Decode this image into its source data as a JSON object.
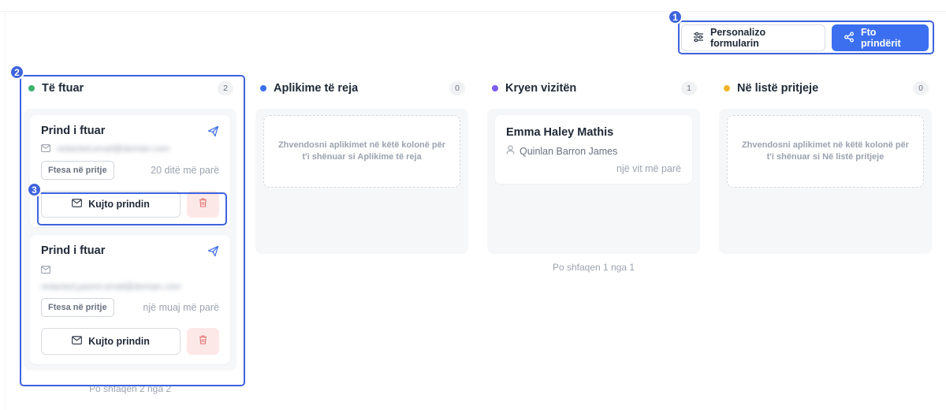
{
  "toolbar": {
    "customize_label": "Personalizo formularin",
    "invite_label": "Fto prindërit"
  },
  "annotations": [
    "1",
    "2",
    "3"
  ],
  "columns": [
    {
      "title": "Të ftuar",
      "count": "2",
      "color": "#3cb371",
      "cards": [
        {
          "title": "Prind i ftuar",
          "email": "redacted.email@domain.com",
          "status": "Ftesa në pritje",
          "time": "20 ditë më parë",
          "remind_label": "Kujto prindin"
        },
        {
          "title": "Prind i ftuar",
          "email": "redacted.parent.email@domain.com",
          "status": "Ftesa në pritje",
          "time": "një muaj më parë",
          "remind_label": "Kujto prindin"
        }
      ],
      "footer": "Po shfaqen 2 nga 2"
    },
    {
      "title": "Aplikime të reja",
      "count": "0",
      "color": "#3b6ff0",
      "empty_text": "Zhvendosni aplikimet në këtë kolonë për t'i shënuar si Aplikime të reja"
    },
    {
      "title": "Kryen vizitën",
      "count": "1",
      "color": "#7c5cf0",
      "card": {
        "name": "Emma Haley Mathis",
        "parent": "Quinlan Barron James",
        "time": "një vit më parë"
      },
      "footer": "Po shfaqen 1 nga 1"
    },
    {
      "title": "Në listë pritjeje",
      "count": "0",
      "color": "#f0b429",
      "empty_text": "Zhvendosni aplikimet në këtë kolonë për t'i shënuar si Në listë pritjeje"
    }
  ]
}
